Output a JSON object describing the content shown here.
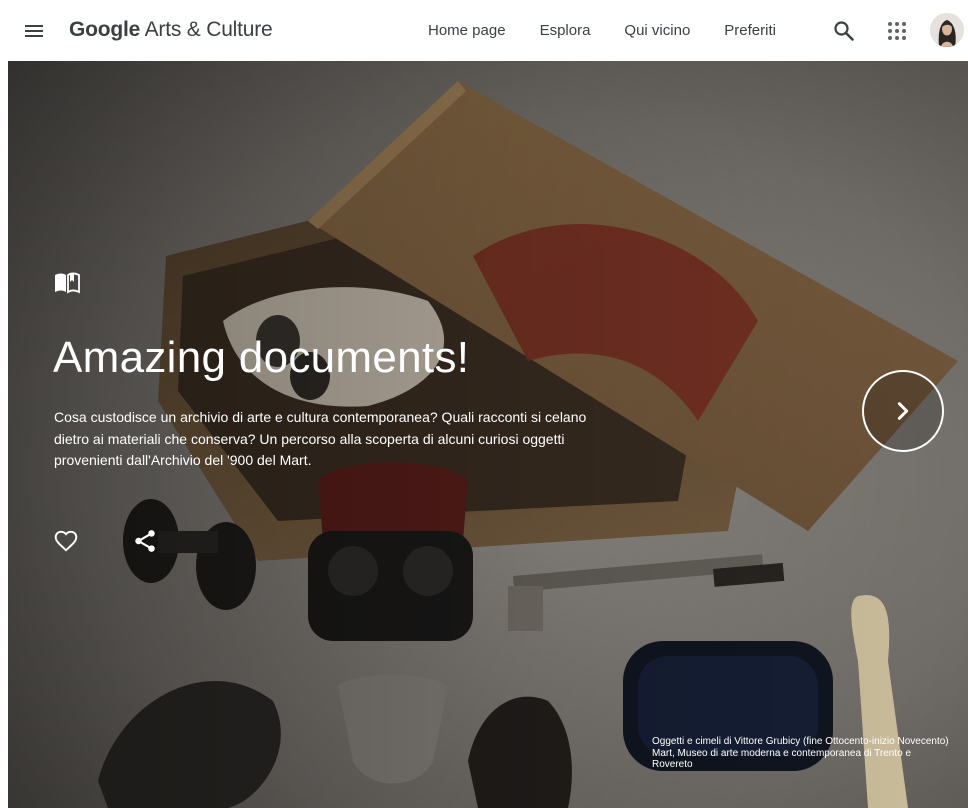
{
  "header": {
    "logo_brand": "Google",
    "logo_rest": " Arts & Culture",
    "nav": [
      {
        "label": "Home page"
      },
      {
        "label": "Esplora"
      },
      {
        "label": "Qui vicino"
      },
      {
        "label": "Preferiti"
      }
    ],
    "icons": {
      "menu": "menu-icon",
      "search": "search-icon",
      "apps": "apps-grid-icon",
      "avatar": "user-avatar"
    }
  },
  "hero": {
    "title": "Amazing documents!",
    "description": "Cosa custodisce un archivio di arte e cultura contemporanea? Quali racconti si celano dietro ai materiali che conserva? Un percorso alla scoperta di alcuni curiosi oggetti provenienti dall'Archivio del '900 del Mart.",
    "caption_line1": "Oggetti e cimeli di Vittore Grubicy (fine Ottocento-inizio Novecento)",
    "caption_line2": "Mart, Museo di arte moderna e contemporanea di Trento e Rovereto",
    "icons": {
      "story": "open-book-icon",
      "like": "heart-outline-icon",
      "share": "share-icon",
      "next": "chevron-right-icon"
    }
  },
  "colors": {
    "header_bg": "#ffffff",
    "header_text": "#3c4043",
    "hero_text": "#ffffff"
  }
}
